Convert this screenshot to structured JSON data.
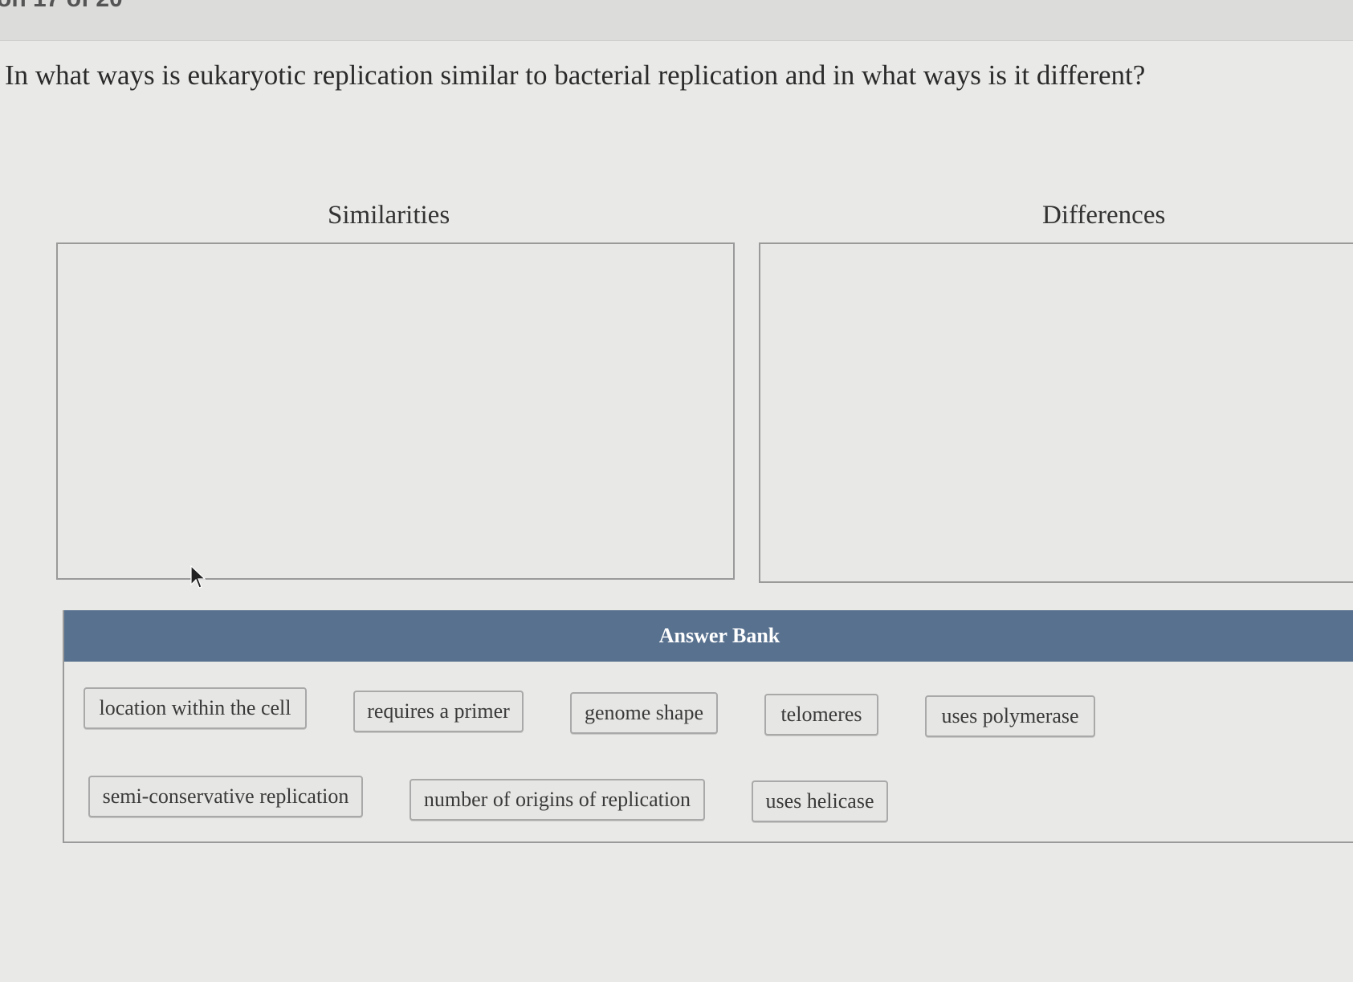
{
  "header": {
    "counter": "on 17 of 20"
  },
  "question": "In what ways is eukaryotic replication similar to bacterial replication and in what ways is it different?",
  "zones": {
    "similarities_title": "Similarities",
    "differences_title": "Differences"
  },
  "answer_bank": {
    "title": "Answer Bank",
    "items": [
      "location within the cell",
      "requires a primer",
      "genome shape",
      "telomeres",
      "uses polymerase",
      "semi-conservative replication",
      "number of origins of replication",
      "uses helicase"
    ]
  },
  "colors": {
    "bank_header": "#58718f",
    "background": "#e9e9e7"
  }
}
